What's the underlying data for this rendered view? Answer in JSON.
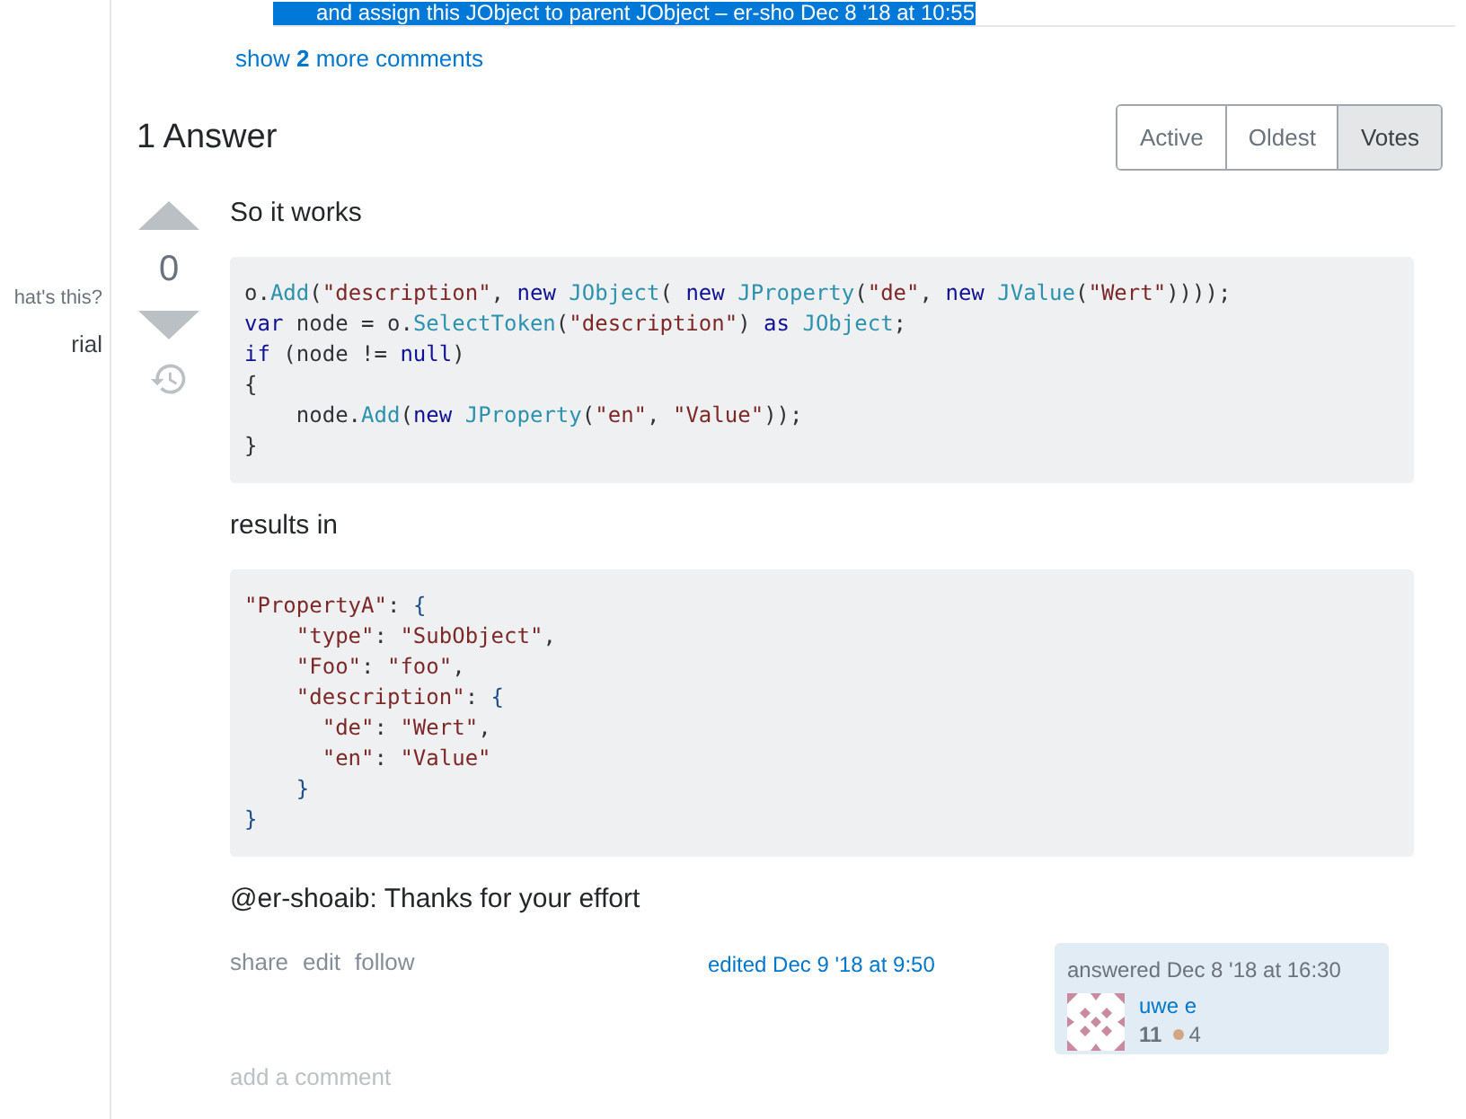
{
  "sidebar": {
    "items": [
      "hat's this?",
      "rial"
    ]
  },
  "question_comment": {
    "text": "and assign this JObject to parent JObject – er-sho Dec 8 '18 at 10:55",
    "selected": true
  },
  "show_more_comments": "show **2** more comments",
  "answers_header": {
    "title": "1 Answer",
    "sort_tabs": [
      {
        "label": "Active",
        "selected": false
      },
      {
        "label": "Oldest",
        "selected": false
      },
      {
        "label": "Votes",
        "selected": true
      }
    ]
  },
  "answer": {
    "vote_count": "0",
    "body": [
      {
        "kind": "paragraph",
        "text": "So it works"
      },
      {
        "kind": "code",
        "lines": [
          [
            {
              "text": "o.",
              "kind": "plain"
            },
            {
              "text": "Add",
              "kind": "type"
            },
            {
              "text": "(",
              "kind": "plain"
            },
            {
              "text": "\"description\"",
              "kind": "string"
            },
            {
              "text": ", ",
              "kind": "plain"
            },
            {
              "text": "new ",
              "kind": "keyword"
            },
            {
              "text": "JObject",
              "kind": "type"
            },
            {
              "text": "( ",
              "kind": "plain"
            },
            {
              "text": "new ",
              "kind": "keyword"
            },
            {
              "text": "JProperty",
              "kind": "type"
            },
            {
              "text": "(",
              "kind": "plain"
            },
            {
              "text": "\"de\"",
              "kind": "string"
            },
            {
              "text": ", ",
              "kind": "plain"
            },
            {
              "text": "new ",
              "kind": "keyword"
            },
            {
              "text": "JValue",
              "kind": "type"
            },
            {
              "text": "(",
              "kind": "plain"
            },
            {
              "text": "\"Wert\"",
              "kind": "string"
            },
            {
              "text": "))));",
              "kind": "plain"
            }
          ],
          [
            {
              "text": "var",
              "kind": "keyword"
            },
            {
              "text": " node = o.",
              "kind": "plain"
            },
            {
              "text": "SelectToken",
              "kind": "type"
            },
            {
              "text": "(",
              "kind": "plain"
            },
            {
              "text": "\"description\"",
              "kind": "string"
            },
            {
              "text": ") ",
              "kind": "plain"
            },
            {
              "text": "as ",
              "kind": "keyword"
            },
            {
              "text": "JObject",
              "kind": "type"
            },
            {
              "text": ";",
              "kind": "plain"
            }
          ],
          [
            {
              "text": "if",
              "kind": "keyword"
            },
            {
              "text": " (node != ",
              "kind": "plain"
            },
            {
              "text": "null",
              "kind": "keyword"
            },
            {
              "text": ")",
              "kind": "plain"
            }
          ],
          [
            {
              "text": "{",
              "kind": "plain"
            }
          ],
          [
            {
              "text": "    node.",
              "kind": "plain"
            },
            {
              "text": "Add",
              "kind": "type"
            },
            {
              "text": "(",
              "kind": "plain"
            },
            {
              "text": "new ",
              "kind": "keyword"
            },
            {
              "text": "JProperty",
              "kind": "type"
            },
            {
              "text": "(",
              "kind": "plain"
            },
            {
              "text": "\"en\"",
              "kind": "string"
            },
            {
              "text": ", ",
              "kind": "plain"
            },
            {
              "text": "\"Value\"",
              "kind": "string"
            },
            {
              "text": "));",
              "kind": "plain"
            }
          ],
          [
            {
              "text": "}",
              "kind": "plain"
            }
          ]
        ]
      },
      {
        "kind": "paragraph",
        "text": "results in"
      },
      {
        "kind": "code",
        "lines": [
          [
            {
              "text": "\"PropertyA\"",
              "kind": "string"
            },
            {
              "text": ": ",
              "kind": "plain"
            },
            {
              "text": "{",
              "kind": "brace"
            }
          ],
          [
            {
              "text": "    \"type\"",
              "kind": "string"
            },
            {
              "text": ": ",
              "kind": "plain"
            },
            {
              "text": "\"SubObject\"",
              "kind": "string"
            },
            {
              "text": ",",
              "kind": "plain"
            }
          ],
          [
            {
              "text": "    \"Foo\"",
              "kind": "string"
            },
            {
              "text": ": ",
              "kind": "plain"
            },
            {
              "text": "\"foo\"",
              "kind": "string"
            },
            {
              "text": ",",
              "kind": "plain"
            }
          ],
          [
            {
              "text": "    \"description\"",
              "kind": "string"
            },
            {
              "text": ": ",
              "kind": "plain"
            },
            {
              "text": "{",
              "kind": "brace"
            }
          ],
          [
            {
              "text": "      \"de\"",
              "kind": "string"
            },
            {
              "text": ": ",
              "kind": "plain"
            },
            {
              "text": "\"Wert\"",
              "kind": "string"
            },
            {
              "text": ",",
              "kind": "plain"
            }
          ],
          [
            {
              "text": "      \"en\"",
              "kind": "string"
            },
            {
              "text": ": ",
              "kind": "plain"
            },
            {
              "text": "\"Value\"",
              "kind": "string"
            }
          ],
          [
            {
              "text": "    }",
              "kind": "brace"
            }
          ],
          [
            {
              "text": "}",
              "kind": "brace"
            }
          ]
        ]
      },
      {
        "kind": "paragraph",
        "text": "@er-shoaib: Thanks for your effort"
      }
    ],
    "actions": [
      "share",
      "edit",
      "follow"
    ],
    "edited": "edited Dec 9 '18 at 9:50",
    "user_card": {
      "answered": "answered Dec 8 '18 at 16:30",
      "name": "uwe e",
      "reputation": "11",
      "bronze_badges": "4"
    },
    "add_comment": "add a comment"
  }
}
